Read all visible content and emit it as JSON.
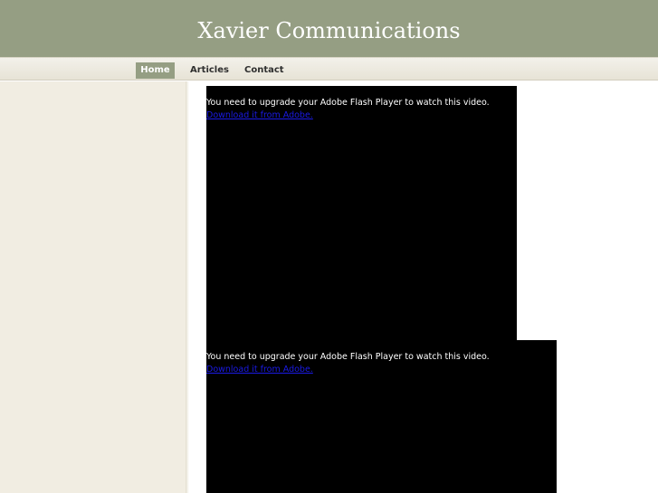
{
  "header": {
    "title": "Xavier Communications"
  },
  "nav": {
    "items": [
      {
        "label": "Home",
        "active": true
      },
      {
        "label": "Articles",
        "active": false
      },
      {
        "label": "Contact",
        "active": false
      }
    ]
  },
  "videos": [
    {
      "message": "You need to upgrade your Adobe Flash Player to watch this video.",
      "link_text": "Download it from Adobe."
    },
    {
      "message": "You need to upgrade your Adobe Flash Player to watch this video.",
      "link_text": "Download it from Adobe."
    }
  ],
  "colors": {
    "header_bg": "#959e83",
    "sidebar_bg": "#f1ede2",
    "video_bg": "#000000",
    "link": "#1a1ae6"
  }
}
